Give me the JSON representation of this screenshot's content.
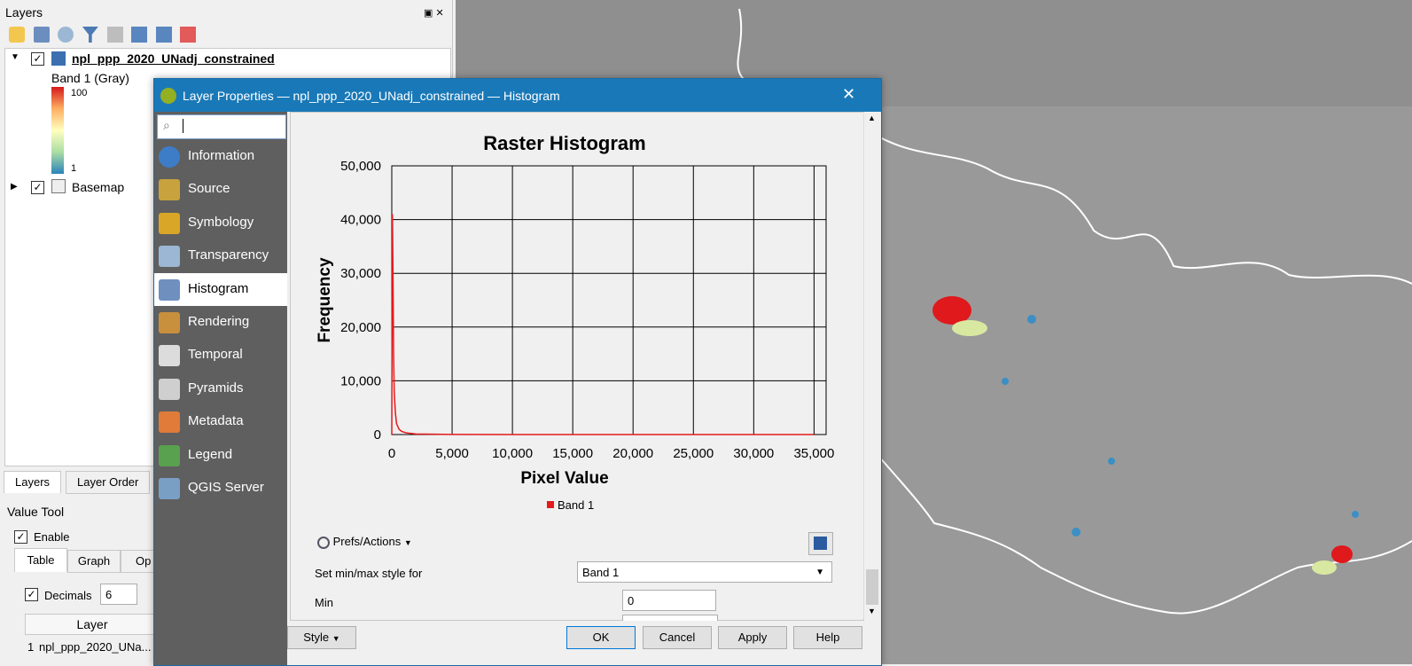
{
  "layers_panel": {
    "title": "Layers",
    "layer1": {
      "name": "npl_ppp_2020_UNadj_constrained",
      "band": "Band 1 (Gray)",
      "max": "100",
      "min": "1"
    },
    "layer2": {
      "name": "Basemap"
    },
    "tabs": [
      "Layers",
      "Layer Order"
    ]
  },
  "value_tool": {
    "title": "Value Tool",
    "enable_label": "Enable",
    "tabs": [
      "Table",
      "Graph",
      "Op"
    ],
    "decimals_label": "Decimals",
    "decimals_value": "6",
    "column_header": "Layer",
    "row_index": "1",
    "row_layer": "npl_ppp_2020_UNa..."
  },
  "dialog": {
    "title": "Layer Properties — npl_ppp_2020_UNadj_constrained — Histogram",
    "search_placeholder": "",
    "nav": [
      {
        "label": "Information",
        "icon": "info-icon"
      },
      {
        "label": "Source",
        "icon": "source-icon"
      },
      {
        "label": "Symbology",
        "icon": "symbology-icon"
      },
      {
        "label": "Transparency",
        "icon": "transparency-icon"
      },
      {
        "label": "Histogram",
        "icon": "histogram-icon"
      },
      {
        "label": "Rendering",
        "icon": "rendering-icon"
      },
      {
        "label": "Temporal",
        "icon": "clock-icon"
      },
      {
        "label": "Pyramids",
        "icon": "pyramids-icon"
      },
      {
        "label": "Metadata",
        "icon": "metadata-icon"
      },
      {
        "label": "Legend",
        "icon": "legend-icon"
      },
      {
        "label": "QGIS Server",
        "icon": "server-icon"
      }
    ],
    "active_nav": "Histogram",
    "prefs_label": "Prefs/Actions",
    "minmax_label": "Set min/max style for",
    "minmax_value": "Band 1",
    "min_label": "Min",
    "min_value": "0",
    "buttons": {
      "style": "Style",
      "ok": "OK",
      "cancel": "Cancel",
      "apply": "Apply",
      "help": "Help"
    }
  },
  "chart_data": {
    "type": "line",
    "title": "Raster Histogram",
    "xlabel": "Pixel Value",
    "ylabel": "Frequency",
    "xlim": [
      0,
      36000
    ],
    "ylim": [
      0,
      50000
    ],
    "xticks": [
      "0",
      "5,000",
      "10,000",
      "15,000",
      "20,000",
      "25,000",
      "30,000",
      "35,000"
    ],
    "yticks": [
      "0",
      "10,000",
      "20,000",
      "30,000",
      "40,000",
      "50,000"
    ],
    "grid": true,
    "legend": "bottom-center",
    "series": [
      {
        "name": "Band 1",
        "color": "#e41a1c",
        "x": [
          0,
          50,
          100,
          150,
          200,
          300,
          400,
          600,
          800,
          1200,
          2000,
          5000,
          10000,
          20000,
          35000
        ],
        "y": [
          0,
          41000,
          30000,
          15000,
          8000,
          4000,
          2000,
          1000,
          600,
          300,
          100,
          20,
          5,
          0,
          0
        ]
      }
    ]
  },
  "colors": {
    "accent": "#1979b8",
    "sidebar": "#5f5f5f",
    "series": "#e41a1c"
  }
}
